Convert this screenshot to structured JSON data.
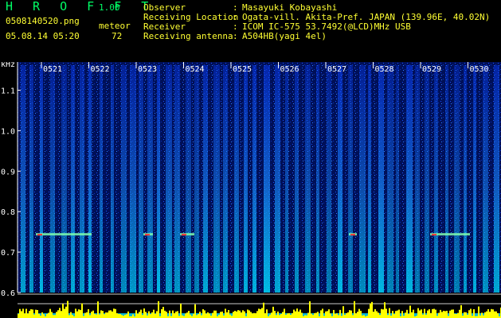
{
  "app": {
    "title": "H R O F F T",
    "version": "1.00",
    "file_name": "0508140520.png",
    "date_time": "05.08.14 05:20",
    "meteor_label": "meteor",
    "meteor_count": "72"
  },
  "info": [
    {
      "label": "Observer",
      "colon": ":",
      "value": "Masayuki Kobayashi"
    },
    {
      "label": "Receiving Location",
      "colon": ":",
      "value": "Ogata-vill. Akita-Pref. JAPAN (139.96E, 40.02N)"
    },
    {
      "label": "Receiver",
      "colon": ":",
      "value": "ICOM IC-575 53.7492(@LCD)MHz USB"
    },
    {
      "label": "Receiving antenna",
      "colon": ":",
      "value": "A504HB(yagi 4el)"
    }
  ],
  "colors": {
    "title": "#00ff66",
    "label": "#ffff33",
    "background": "#000000",
    "spectrogram_low": "#000a3c",
    "spectrogram_high": "#00ffff",
    "echo": "#ff3333",
    "amplitude": "#ffff00"
  },
  "chart_data": {
    "type": "heatmap",
    "y_unit": "kHz",
    "y_ticks": [
      "1.1",
      "1.0",
      "0.9",
      "0.8",
      "0.7",
      "0.6"
    ],
    "ylim": [
      0.6,
      1.15
    ],
    "time_marks": [
      "0521",
      "0522",
      "0523",
      "0524",
      "0525",
      "0526",
      "0527",
      "0528",
      "0529",
      "0530"
    ],
    "echo_frequency_khz": 0.745
  }
}
